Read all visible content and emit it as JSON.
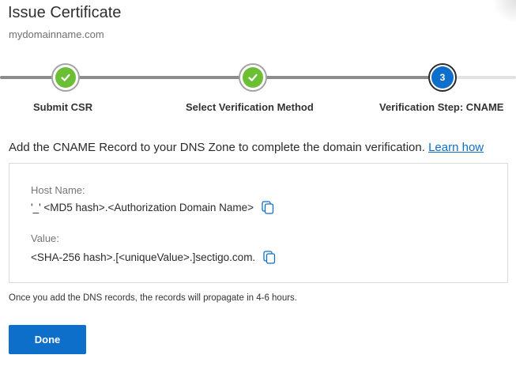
{
  "header": {
    "title": "Issue Certificate",
    "domain": "mydomainname.com"
  },
  "stepper": {
    "steps": [
      {
        "label": "Submit CSR",
        "status": "complete",
        "icon": "check-icon"
      },
      {
        "label": "Select Verification Method",
        "status": "complete",
        "icon": "check-icon"
      },
      {
        "label": "Verification Step: CNAME",
        "status": "current",
        "number": "3"
      }
    ]
  },
  "instruction": {
    "text": "Add the CNAME Record to your DNS Zone to complete the domain verification. ",
    "link": "Learn how"
  },
  "record": {
    "host_label": "Host Name:",
    "host_value": "'_' <MD5 hash>.<Authorization Domain Name>",
    "value_label": "Value:",
    "value_value": "<SHA-256 hash>.[<uniqueValue>.]sectigo.com.",
    "copy_icon": "copy-icon"
  },
  "note": "Once you add the DNS records, the records will propagate in 4-6 hours.",
  "done_label": "Done",
  "colors": {
    "accent": "#0d6fc9",
    "complete_green": "#6cbf34",
    "track_done": "#8c8c8c",
    "track_todo": "#e2e2e2"
  }
}
